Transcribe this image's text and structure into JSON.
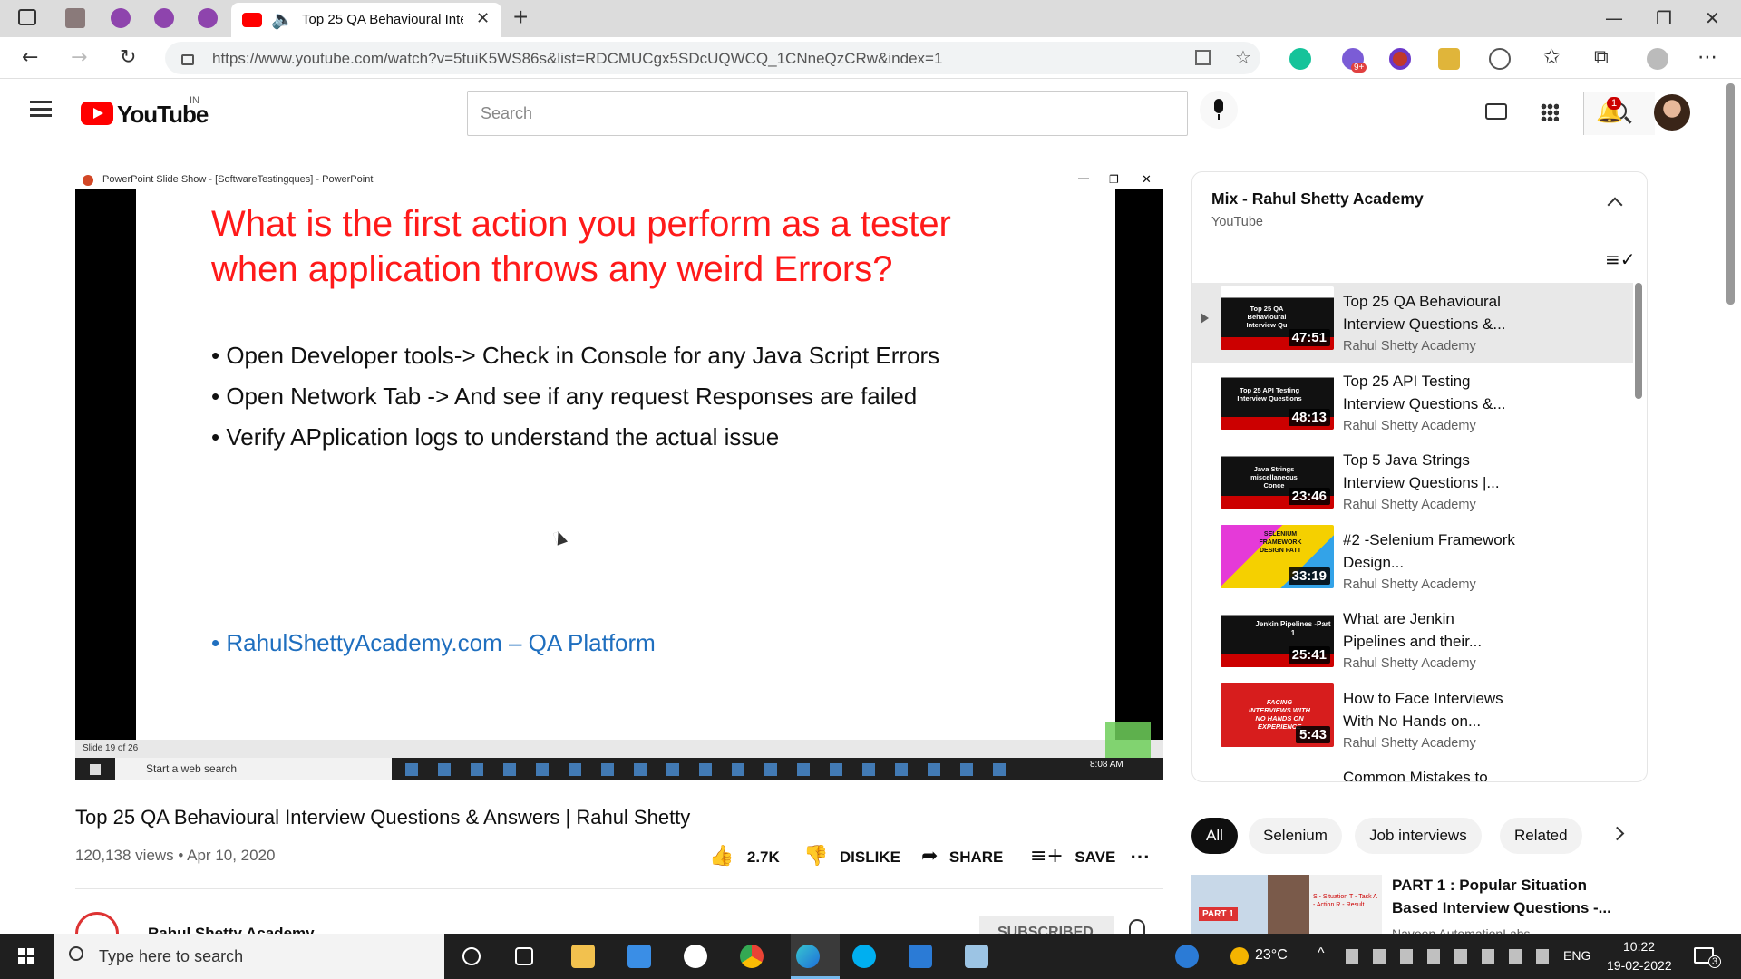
{
  "browser": {
    "active_tab_title": "Top 25 QA Behavioural Inter",
    "url": "https://www.youtube.com/watch?v=5tuiK5WS86s&list=RDCMUCgx5SDcUQWCQ_1CNneQzCRw&index=1",
    "ext_badge": "9+"
  },
  "youtube": {
    "logo_text": "YouTube",
    "region": "IN",
    "search_placeholder": "Search",
    "notif_count": "1"
  },
  "slide_window": {
    "title": "PowerPoint Slide Show - [SoftwareTestingques] - PowerPoint",
    "heading_line1": "What is the first action you perform as a tester",
    "heading_line2": "when application throws any weird Errors?",
    "bullets": [
      "Open Developer tools-> Check in Console for any Java Script Errors",
      "Open Network Tab -> And see if any request Responses are failed",
      "Verify APplication logs to understand the actual issue"
    ],
    "link_bullet": "RahulShettyAcademy.com – QA Platform",
    "slide_counter": "Slide 19 of 26",
    "inner_search": "Start a web search",
    "inner_clock": "8:08 AM"
  },
  "video": {
    "title": "Top 25 QA Behavioural Interview Questions & Answers | Rahul Shetty",
    "views_date": "120,138 views • Apr 10, 2020",
    "likes": "2.7K",
    "dislike": "DISLIKE",
    "share": "SHARE",
    "save": "SAVE",
    "channel_partial": "Rahul Shetty Academy",
    "subscribed_partial": "SUBSCRIBED"
  },
  "playlist": {
    "title": "Mix - Rahul Shetty Academy",
    "subtitle": "YouTube",
    "items": [
      {
        "title": "Top 25 QA Behavioural Interview Questions &...",
        "channel": "Rahul Shetty Academy",
        "duration": "47:51",
        "thumb_text": "Top 25 QA Behavioural Interview Qu"
      },
      {
        "title": "Top 25 API Testing Interview Questions &...",
        "channel": "Rahul Shetty Academy",
        "duration": "48:13",
        "thumb_text": "Top 25 API Testing Interview Questions"
      },
      {
        "title": "Top 5 Java Strings Interview Questions |...",
        "channel": "Rahul Shetty Academy",
        "duration": "23:46",
        "thumb_text": "Java Strings miscellaneous Conce"
      },
      {
        "title": "#2 -Selenium Framework Design...",
        "channel": "Rahul Shetty Academy",
        "duration": "33:19",
        "thumb_text": "SELENIUM FRAMEWORK DESIGN PATT"
      },
      {
        "title": "What are Jenkin Pipelines and their...",
        "channel": "Rahul Shetty Academy",
        "duration": "25:41",
        "thumb_text": "Jenkin Pipelines -Part 1"
      },
      {
        "title": "How to Face Interviews With No Hands on...",
        "channel": "Rahul Shetty Academy",
        "duration": "5:43",
        "thumb_text": "FACING INTERVIEWS WITH NO HANDS ON EXPERIENCE"
      },
      {
        "title": "Common Mistakes to",
        "channel": "",
        "duration": "",
        "thumb_text": ""
      }
    ]
  },
  "chips": [
    "All",
    "Selenium",
    "Job interviews",
    "Related"
  ],
  "related": {
    "title_line1": "PART 1 : Popular Situation",
    "title_line2": "Based Interview Questions -...",
    "channel_partial": "Naveen AutomationLabs",
    "thumb_text": "PART 1",
    "thumb_side": "S - Situation T - Task A - Action R - Result"
  },
  "taskbar": {
    "search_placeholder": "Type here to search",
    "temperature": "23°C",
    "language": "ENG",
    "time": "10:22",
    "date": "19-02-2022",
    "notif_count": "3"
  }
}
